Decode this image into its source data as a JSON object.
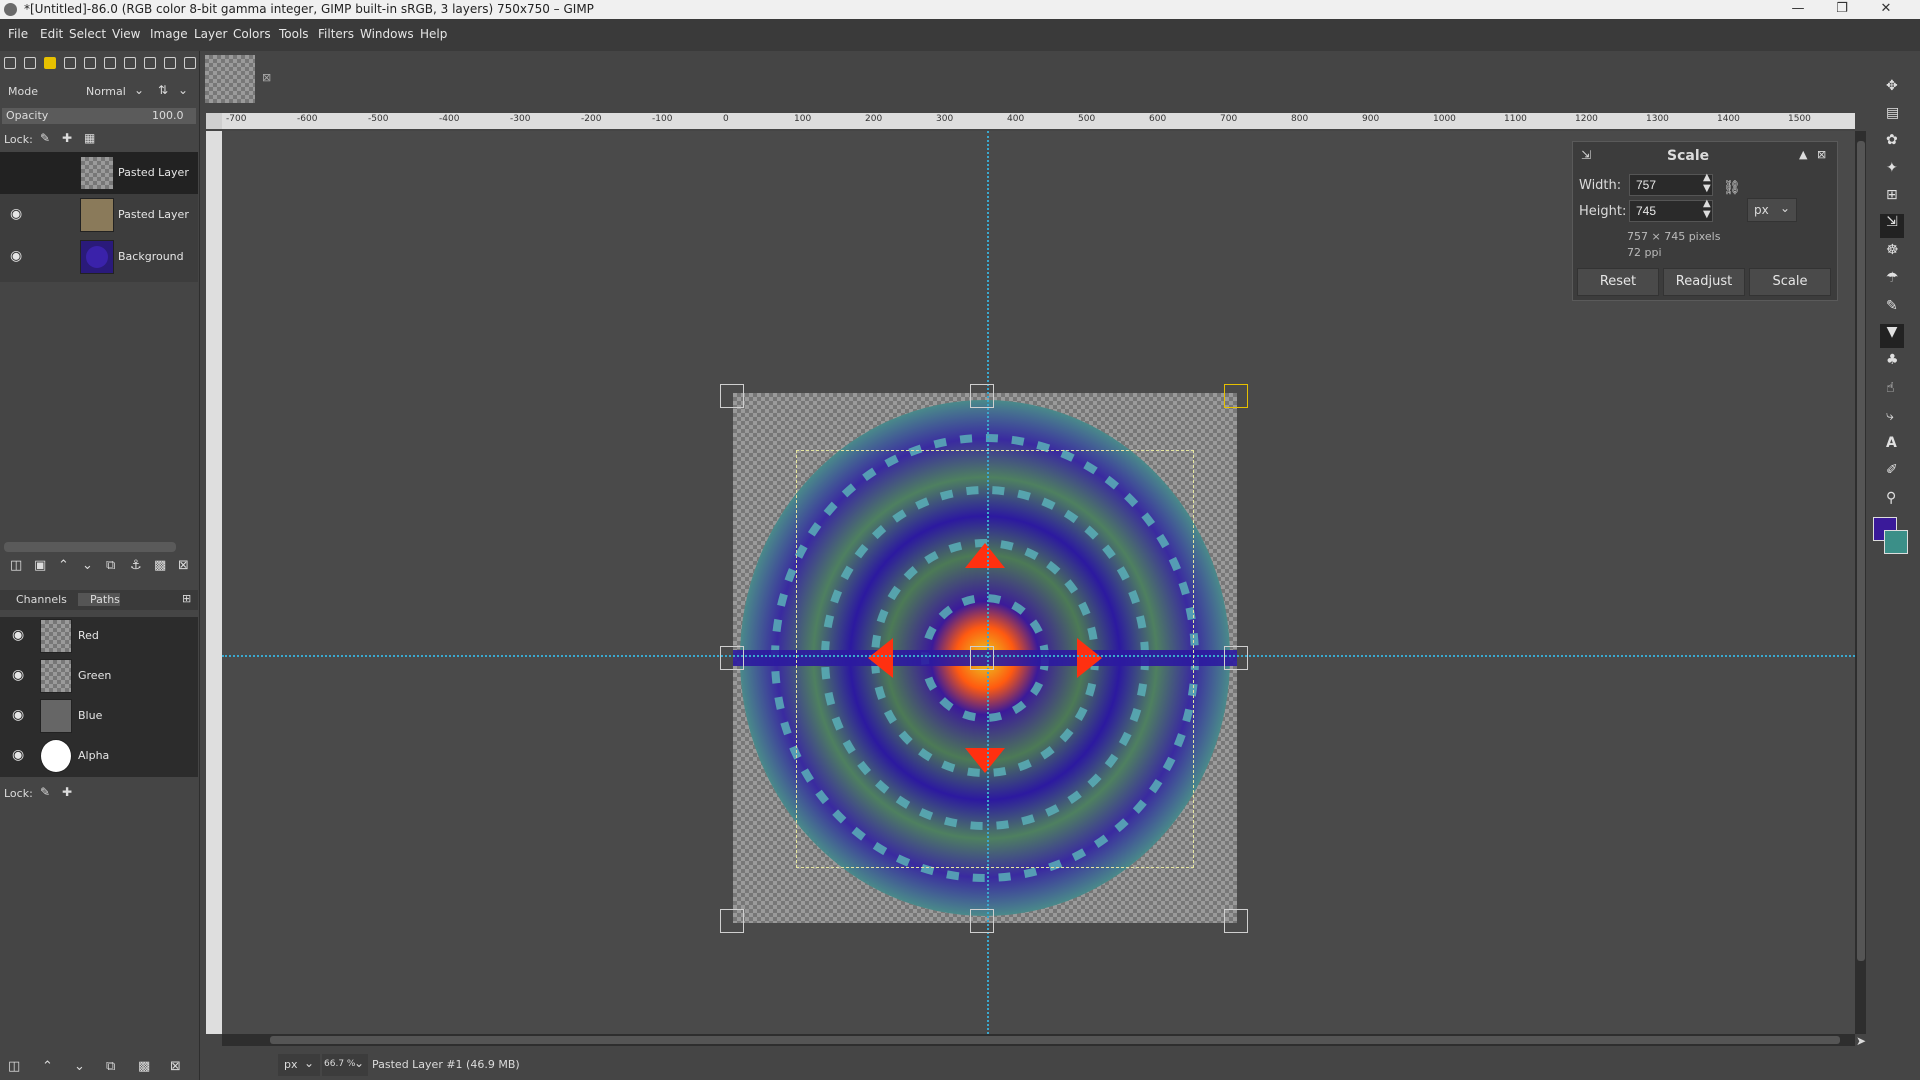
{
  "window": {
    "title": "*[Untitled]-86.0 (RGB color 8-bit gamma integer, GIMP built-in sRGB, 3 layers) 750x750 – GIMP"
  },
  "menubar": {
    "items": [
      "File",
      "Edit",
      "Select",
      "View",
      "Image",
      "Layer",
      "Colors",
      "Tools",
      "Filters",
      "Windows",
      "Help"
    ]
  },
  "layers_panel": {
    "mode_label": "Mode",
    "mode_value": "Normal",
    "opacity_label": "Opacity",
    "opacity_value": "100.0",
    "lock_label": "Lock:",
    "layers": [
      {
        "name": "Pasted Layer",
        "visible": false
      },
      {
        "name": "Pasted Layer",
        "visible": true
      },
      {
        "name": "Background",
        "visible": true
      }
    ]
  },
  "channels_panel": {
    "tabs": [
      "Channels",
      "Paths"
    ],
    "channels": [
      {
        "name": "Red"
      },
      {
        "name": "Green"
      },
      {
        "name": "Blue"
      },
      {
        "name": "Alpha"
      }
    ],
    "lock_label": "Lock:"
  },
  "ruler": {
    "h_labels": [
      "-700",
      "-600",
      "-500",
      "-400",
      "-300",
      "-200",
      "-100",
      "0",
      "100",
      "200",
      "300",
      "400",
      "500",
      "600",
      "700",
      "800",
      "900",
      "1000",
      "1100",
      "1200",
      "1300",
      "1400",
      "1500"
    ]
  },
  "scale_dialog": {
    "title": "Scale",
    "width_label": "Width:",
    "width_value": "757",
    "height_label": "Height:",
    "height_value": "745",
    "unit": "px",
    "dimensions_text": "757 × 745 pixels",
    "resolution_text": "72 ppi",
    "reset_label": "Reset",
    "readjust_label": "Readjust",
    "scale_label": "Scale"
  },
  "statusbar": {
    "unit": "px",
    "zoom": "66.7 %",
    "message": "Pasted Layer #1 (46.9 MB)"
  },
  "colors": {
    "fg": "#3a1a9a",
    "bg": "#3b8f88"
  }
}
